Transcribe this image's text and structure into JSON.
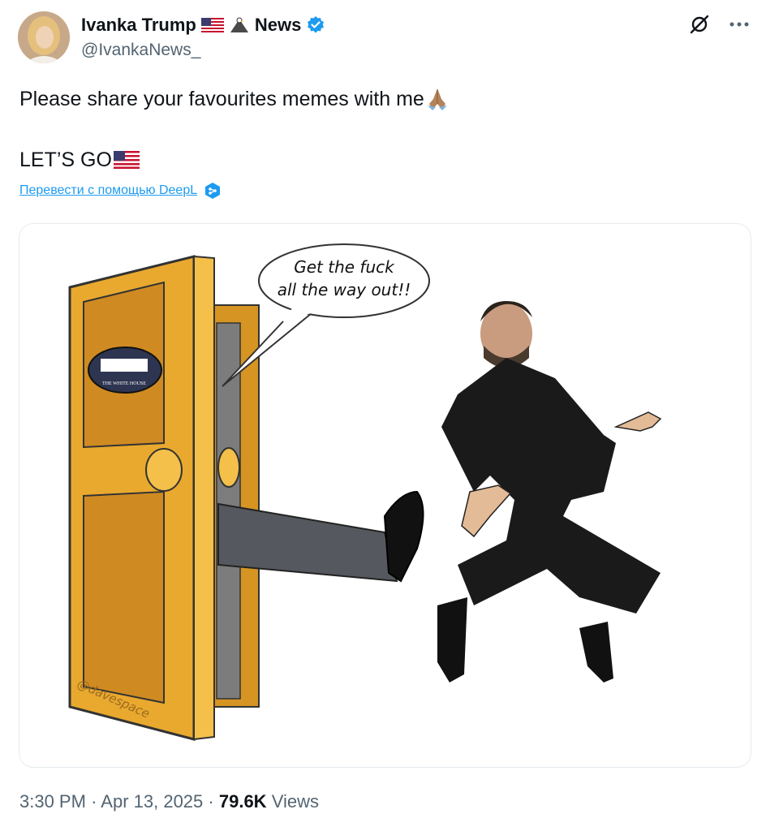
{
  "author": {
    "name": "Ivanka Trump",
    "suffix": "News",
    "handle": "@IvankaNews_",
    "avatar_icon": "profile-photo"
  },
  "tweet": {
    "line1": "Please share your favourites  memes  with me",
    "line2": "LET’S GO",
    "translate_link": "Перевести с помощью DeepL"
  },
  "media": {
    "speech_bubble": "Get the fuck all the way out!!",
    "sign_text": "THE WHITE HOUSE",
    "watermark": "@davespace"
  },
  "meta": {
    "time": "3:30 PM",
    "date": "Apr 13, 2025",
    "views_count": "79.6K",
    "views_label": "Views"
  },
  "colors": {
    "verified": "#1d9bf0",
    "link": "#1d9bf0",
    "door": "#e9a92e"
  }
}
